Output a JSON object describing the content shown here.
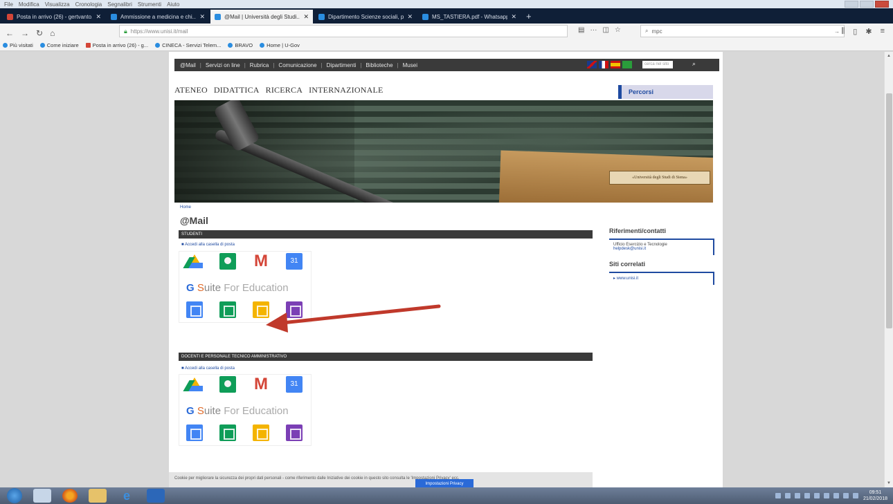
{
  "menubar": {
    "items": [
      "File",
      "Modifica",
      "Visualizza",
      "Cronologia",
      "Segnalibri",
      "Strumenti",
      "Aiuto"
    ]
  },
  "tabs": [
    {
      "label": "Posta in arrivo (26) - gertvanto...",
      "icon": "gmail-icon"
    },
    {
      "label": "Ammissione a medicina e chi...",
      "icon": "drive-icon"
    },
    {
      "label": "@Mail | Università degli Studi...",
      "icon": "drive-icon",
      "active": true
    },
    {
      "label": "Dipartimento Scienze sociali, p...",
      "icon": "drive-icon"
    },
    {
      "label": "MS_TASTIERA.pdf - Whatsapp...",
      "icon": "drive-icon"
    }
  ],
  "navbar": {
    "url": "https://www.unisi.it/mail",
    "search_text": "mpc",
    "bookmarks": [
      "Più visitati",
      "Come iniziare",
      "Posta in arrivo (26) - g...",
      "CINECA - Servizi Telem...",
      "BRAVO",
      "Home | U-Gov"
    ]
  },
  "page": {
    "topnav": {
      "items": [
        "@Mail",
        "Servizi on line",
        "Rubrica",
        "Comunicazione",
        "Dipartimenti",
        "Biblioteche",
        "Musei"
      ],
      "search_placeholder": "cerca nel sito"
    },
    "mainnav": [
      "ATENEO",
      "DIDATTICA",
      "RICERCA",
      "INTERNAZIONALE"
    ],
    "percorsi": "Percorsi",
    "plaque": "«Università degli Studi di Siena»",
    "breadcrumb": "Home",
    "title": "@Mail",
    "section1": {
      "header": "STUDENTI",
      "link": "■ Accedi alla casella di posta"
    },
    "section2": {
      "header": "DOCENTI E PERSONALE TECNICO AMMINISTRATIVO",
      "link": "■ Accedi alla casella di posta"
    },
    "gsuite": {
      "g": "G",
      "s": "S",
      "uite": "uite",
      "rest": " For Education",
      "cal_number": "31"
    },
    "sidebar": {
      "ref_title": "Riferimenti/contatti",
      "ref_line1": "Ufficio Esercizio e Tecnologie",
      "ref_line2": "helpdesk@unisi.it",
      "sites_title": "Siti correlati",
      "sites_link": "▸ www.unisi.it"
    },
    "cookie_text": "Cookie per migliorare la sicurezza dei propri dati personali - come riferimento dalle Iniziative dei cookie in questo sito consulta le 'Impostazioni Privacy' ecc.",
    "cookie_button": "Impostazioni Privacy"
  },
  "taskbar": {
    "time": "09:51",
    "date": "21/02/2018"
  }
}
